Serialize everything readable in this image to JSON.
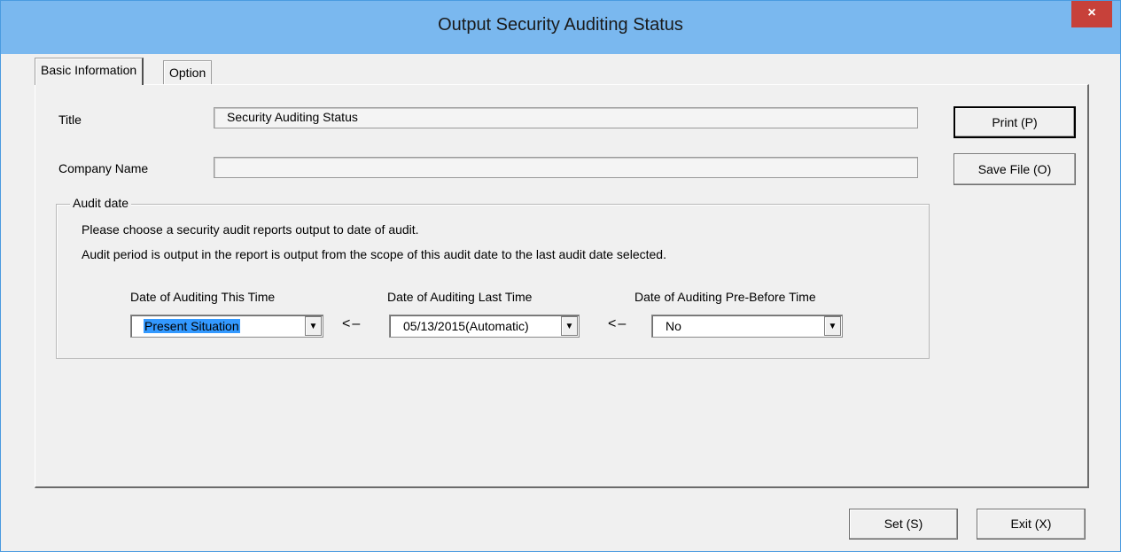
{
  "window": {
    "title": "Output Security Auditing Status",
    "close_glyph": "×"
  },
  "tabs": [
    {
      "label": "Basic Information",
      "active": true
    },
    {
      "label": "Option",
      "active": false
    }
  ],
  "form": {
    "title_label": "Title",
    "title_value": "Security Auditing Status",
    "company_label": "Company Name",
    "company_value": ""
  },
  "buttons": {
    "print": "Print (P)",
    "save_file": "Save File (O)",
    "set": "Set (S)",
    "exit": "Exit (X)"
  },
  "audit_date": {
    "legend": "Audit date",
    "instruction_1": "Please choose a security audit reports output to date of audit.",
    "instruction_2": "Audit period is output in the report is output from the scope of this audit date to the last audit date selected.",
    "this_time_label": "Date of Auditing This Time",
    "this_time_value": "Present Situation",
    "last_time_label": "Date of Auditing Last Time",
    "last_time_value": "05/13/2015(Automatic)",
    "pre_before_label": "Date of Auditing Pre-Before Time",
    "pre_before_value": "No",
    "arrow": "<–"
  },
  "icons": {
    "dropdown": "▼"
  },
  "colors": {
    "titlebar": "#7ab8ef",
    "close_button": "#c7413a",
    "selection": "#3399ff",
    "background": "#f0f0f0"
  }
}
